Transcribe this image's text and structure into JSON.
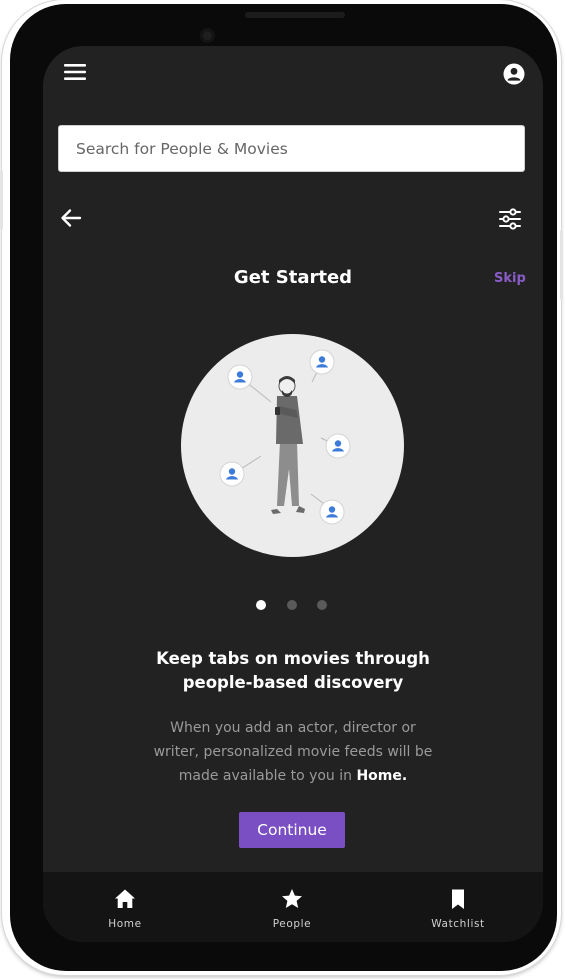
{
  "search": {
    "placeholder": "Search for People & Movies"
  },
  "header": {
    "title": "Get Started",
    "skip_label": "Skip"
  },
  "carousel": {
    "page_count": 3,
    "active_index": 0
  },
  "content": {
    "headline_line1": "Keep tabs on movies through",
    "headline_line2": "people-based discovery",
    "body_line1": "When you add an actor, director or",
    "body_line2": "writer, personalized movie feeds will be",
    "body_line3_prefix": "made available to you in",
    "body_line3_link": "Home."
  },
  "continue_label": "Continue",
  "bottom_nav": {
    "items": [
      {
        "label": "Home",
        "icon": "home-icon"
      },
      {
        "label": "People",
        "icon": "star-icon"
      },
      {
        "label": "Watchlist",
        "icon": "bookmark-icon"
      }
    ]
  },
  "colors": {
    "accent": "#7a4fc4",
    "skip": "#8a5cc8",
    "screen_bg": "#222222",
    "nav_bg": "#141414",
    "person_icon": "#3d7bd9"
  }
}
